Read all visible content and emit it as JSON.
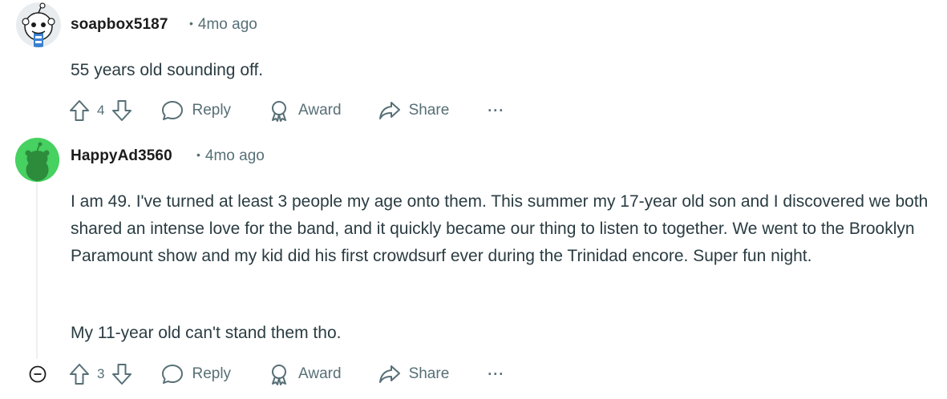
{
  "comments": [
    {
      "username": "soapbox5187",
      "time": "4mo ago",
      "dot": "•",
      "paragraphs": [
        "55 years old sounding off."
      ],
      "votes": "4",
      "actions": {
        "reply": "Reply",
        "award": "Award",
        "share": "Share",
        "more": "···"
      }
    },
    {
      "username": "HappyAd3560",
      "time": "4mo ago",
      "dot": "•",
      "paragraphs": [
        "I am 49. I've turned at least 3 people my age onto them. This summer my 17-year old son and I discovered we both shared an intense love for the band, and it quickly became our thing to listen to together. We went to the Brooklyn Paramount show and my kid did his first crowdsurf ever during the Trinidad encore. Super fun night.",
        "My 11-year old can't stand them tho."
      ],
      "votes": "3",
      "actions": {
        "reply": "Reply",
        "award": "Award",
        "share": "Share",
        "more": "···"
      }
    }
  ],
  "colors": {
    "meta": "#576f76",
    "avatar_green": "#46d160",
    "avatar_blue": "#3b7fd0"
  },
  "icons": [
    "upvote-icon",
    "downvote-icon",
    "reply-icon",
    "award-icon",
    "share-icon",
    "more-icon",
    "collapse-icon"
  ]
}
